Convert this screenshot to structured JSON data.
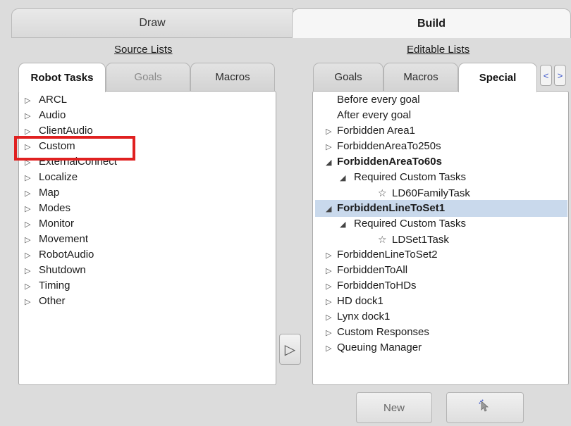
{
  "mode_tabs": {
    "draw": "Draw",
    "build": "Build"
  },
  "source": {
    "title": "Source Lists",
    "tabs": [
      "Robot Tasks",
      "Goals",
      "Macros"
    ],
    "items": [
      "ARCL",
      "Audio",
      "ClientAudio",
      "Custom",
      "ExternalConnect",
      "Localize",
      "Map",
      "Modes",
      "Monitor",
      "Movement",
      "RobotAudio",
      "Shutdown",
      "Timing",
      "Other"
    ]
  },
  "editable": {
    "title": "Editable Lists",
    "tabs": [
      "Goals",
      "Macros",
      "Special"
    ],
    "nav_left": "<",
    "nav_right": ">",
    "items": [
      {
        "text": "Before every goal",
        "marker": ""
      },
      {
        "text": "After every goal",
        "marker": ""
      },
      {
        "text": "Forbidden Area1",
        "marker": "▷"
      },
      {
        "text": "ForbiddenAreaTo250s",
        "marker": "▷"
      },
      {
        "text": "ForbiddenAreaTo60s",
        "marker": "◢"
      },
      {
        "text": "Required Custom Tasks",
        "marker": "◢"
      },
      {
        "text": "LD60FamilyTask",
        "marker": "☆"
      },
      {
        "text": "ForbiddenLineToSet1",
        "marker": "◢"
      },
      {
        "text": "Required Custom Tasks",
        "marker": "◢"
      },
      {
        "text": "LDSet1Task",
        "marker": "☆"
      },
      {
        "text": "ForbiddenLineToSet2",
        "marker": "▷"
      },
      {
        "text": "ForbiddenToAll",
        "marker": "▷"
      },
      {
        "text": "ForbiddenToHDs",
        "marker": "▷"
      },
      {
        "text": "HD dock1",
        "marker": "▷"
      },
      {
        "text": "Lynx dock1",
        "marker": "▷"
      },
      {
        "text": "Custom Responses",
        "marker": "▷"
      },
      {
        "text": "Queuing Manager",
        "marker": "▷"
      }
    ]
  },
  "transfer_button": "▷",
  "bottom": {
    "new_label": "New"
  },
  "icons": {
    "expand": "triangle-right-icon",
    "collapse": "triangle-down-icon",
    "task": "star-outline-icon",
    "pointer": "cursor-click-icon"
  },
  "colors": {
    "highlight": "#e02020",
    "selection": "#c9d9ec"
  }
}
